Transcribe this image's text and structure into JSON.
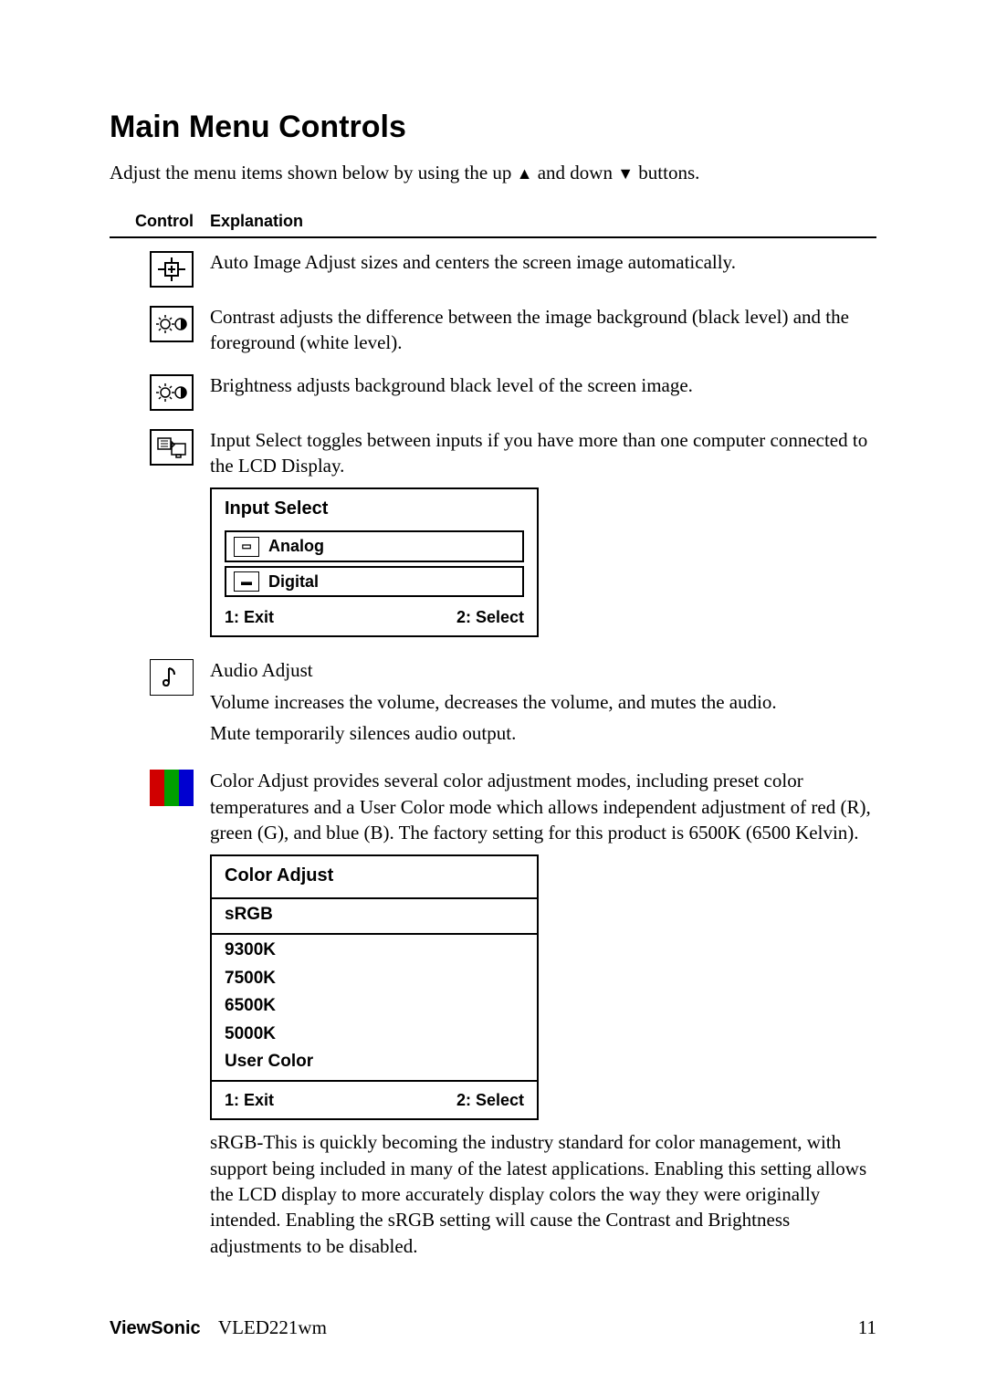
{
  "page": {
    "title": "Main Menu Controls",
    "intro_prefix": "Adjust the menu items shown below by using the up ",
    "intro_mid": " and down ",
    "intro_suffix": " buttons.",
    "col_control": "Control",
    "col_explanation": "Explanation"
  },
  "controls": {
    "auto_image": "Auto Image Adjust sizes and centers the screen image automatically.",
    "contrast": "Contrast adjusts the difference between the image background (black level) and the foreground (white level).",
    "brightness": "Brightness adjusts background black level of the screen image.",
    "input_select": "Input Select toggles between inputs if you have more than one computer connected to the LCD Display.",
    "audio_title": "Audio Adjust",
    "audio_volume": "Volume increases the volume, decreases the volume, and mutes the audio.",
    "audio_mute": "Mute temporarily silences audio output.",
    "color_adjust": "Color Adjust provides several color adjustment modes, including preset color temperatures and a User Color mode which allows independent adjustment of red (R), green (G), and blue (B). The factory setting for this product is 6500K (6500 Kelvin).",
    "srgb_note": "sRGB-This is quickly becoming the industry standard for color management, with support being included in many of the latest applications. Enabling this setting allows the LCD display to more accurately display colors the way they were originally intended. Enabling the sRGB setting will cause the Contrast and Brightness adjustments to be disabled."
  },
  "osd_input": {
    "title": "Input Select",
    "opt1": "Analog",
    "opt2": "Digital",
    "exit": "1: Exit",
    "select": "2: Select"
  },
  "osd_color": {
    "title": "Color Adjust",
    "items": [
      "sRGB",
      "9300K",
      "7500K",
      "6500K",
      "5000K",
      "User Color"
    ],
    "exit": "1: Exit",
    "select": "2: Select"
  },
  "footer": {
    "brand": "ViewSonic",
    "model": "VLED221wm",
    "page_num": "11"
  }
}
